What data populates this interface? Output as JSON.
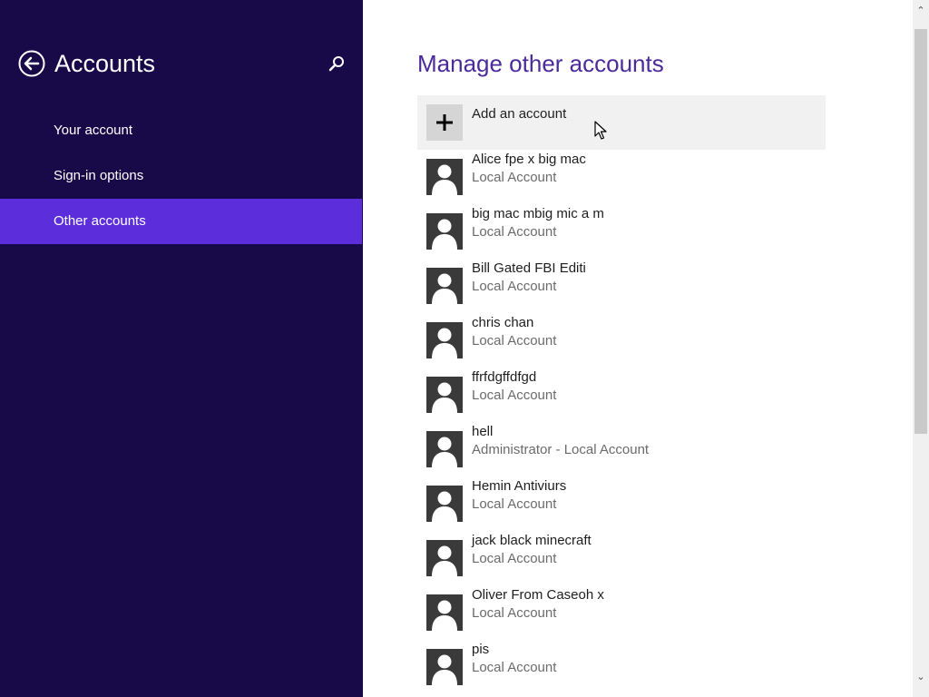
{
  "sidebar": {
    "title": "Accounts",
    "back_icon": "back-arrow-icon",
    "search_icon": "search-icon",
    "items": [
      {
        "label": "Your account"
      },
      {
        "label": "Sign-in options"
      },
      {
        "label": "Other accounts",
        "selected": true
      }
    ]
  },
  "main": {
    "title": "Manage other accounts",
    "add_account": {
      "label": "Add an account",
      "icon": "plus-icon"
    },
    "accounts": [
      {
        "name": "Alice fpe x big mac",
        "type": "Local Account"
      },
      {
        "name": "big mac mbig mic a m",
        "type": "Local Account"
      },
      {
        "name": "Bill Gated FBI Editi",
        "type": "Local Account"
      },
      {
        "name": "chris chan",
        "type": "Local Account"
      },
      {
        "name": "ffrfdgffdfgd",
        "type": "Local Account"
      },
      {
        "name": "hell",
        "type": "Administrator - Local Account"
      },
      {
        "name": "Hemin Antiviurs",
        "type": "Local Account"
      },
      {
        "name": "jack black minecraft",
        "type": "Local Account"
      },
      {
        "name": "Oliver From Caseoh x",
        "type": "Local Account"
      },
      {
        "name": "pis",
        "type": "Local Account"
      }
    ]
  },
  "colors": {
    "sidebar_bg": "#180a48",
    "selected_bg": "#5b2ddb",
    "title_color": "#4b2a9a"
  }
}
